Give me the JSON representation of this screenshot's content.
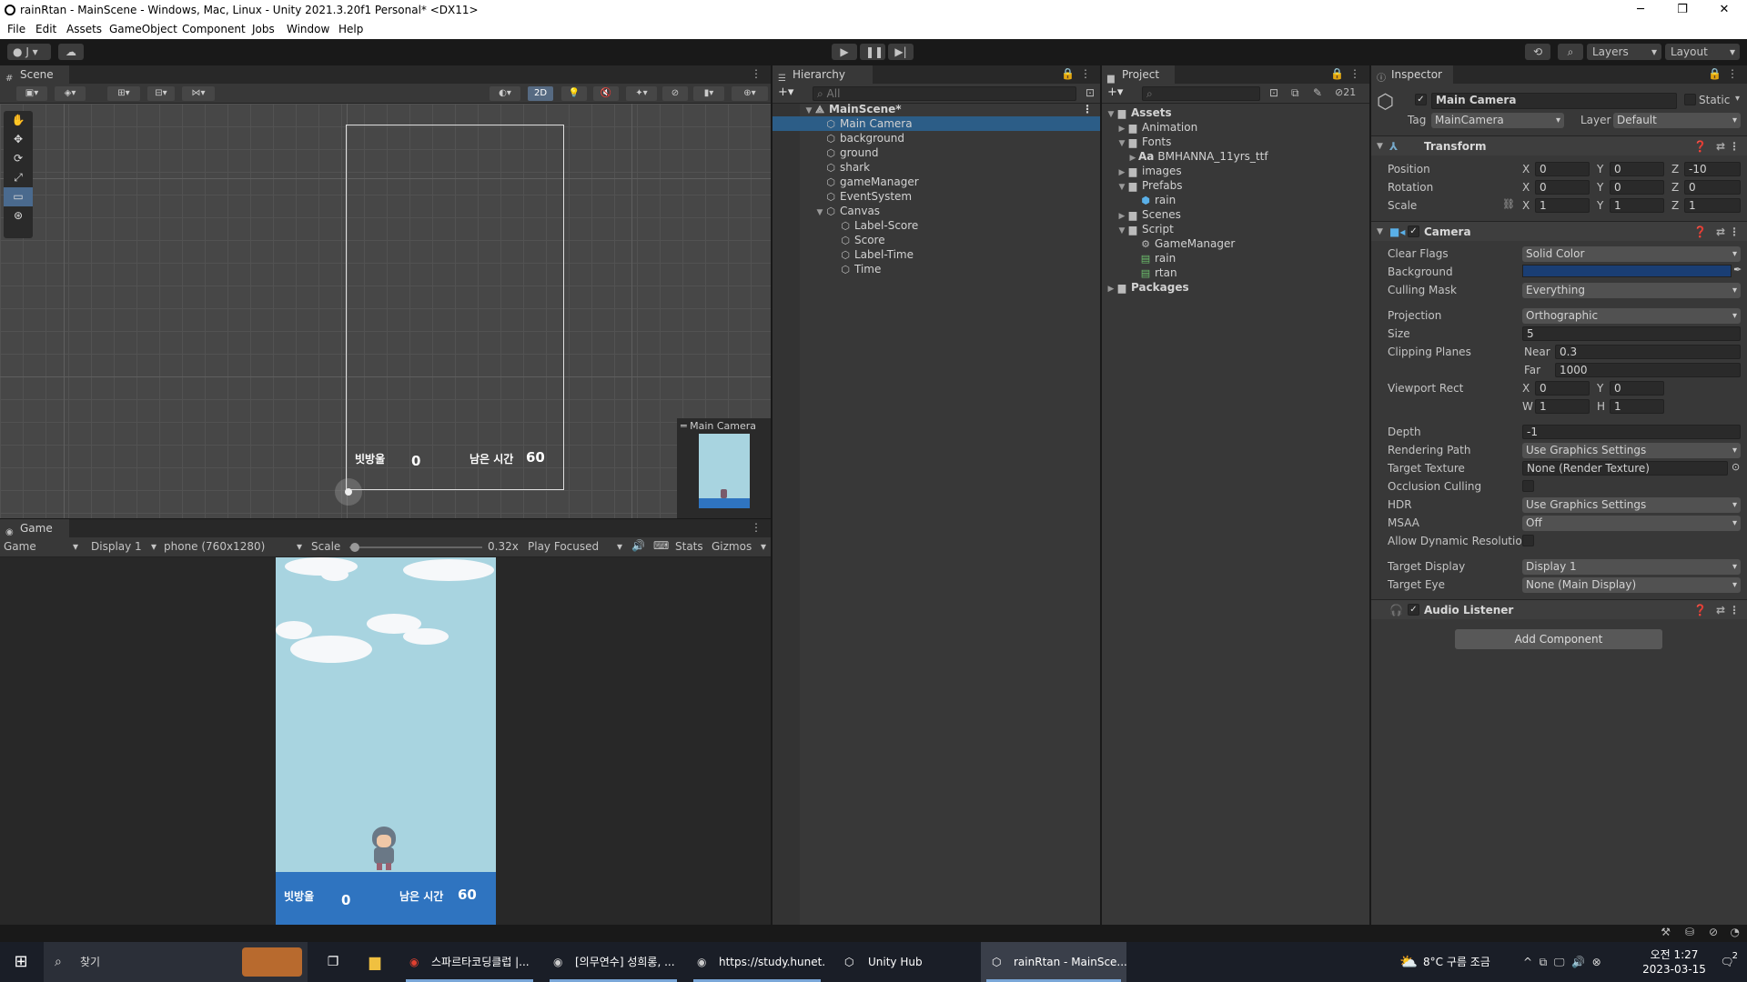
{
  "window": {
    "title": "rainRtan - MainScene - Windows, Mac, Linux - Unity 2021.3.20f1 Personal* <DX11>"
  },
  "menu": [
    "File",
    "Edit",
    "Assets",
    "GameObject",
    "Component",
    "Jobs",
    "Window",
    "Help"
  ],
  "toolbar": {
    "account": "J",
    "layers": "Layers",
    "layout": "Layout"
  },
  "scene": {
    "tab": "Scene",
    "mode_2d": "2D",
    "ui_label_score": "빗방울",
    "ui_score": "0",
    "ui_label_time": "남은 시간",
    "ui_time": "60",
    "camera_preview_title": "Main Camera"
  },
  "game": {
    "tab": "Game",
    "mode": "Game",
    "display": "Display 1",
    "resolution": "phone (760x1280)",
    "scale_label": "Scale",
    "scale_value": "0.32x",
    "focus": "Play Focused",
    "stats": "Stats",
    "gizmos": "Gizmos",
    "label_score": "빗방울",
    "score": "0",
    "label_time": "남은 시간",
    "time": "60",
    "scale_fraction": 0.32
  },
  "hierarchy": {
    "tab": "Hierarchy",
    "search_placeholder": "All",
    "scene_name": "MainScene*",
    "items": [
      {
        "label": "Main Camera",
        "selected": true
      },
      {
        "label": "background"
      },
      {
        "label": "ground"
      },
      {
        "label": "shark"
      },
      {
        "label": "gameManager"
      },
      {
        "label": "EventSystem"
      },
      {
        "label": "Canvas"
      },
      {
        "label": "Label-Score"
      },
      {
        "label": "Score"
      },
      {
        "label": "Label-Time"
      },
      {
        "label": "Time"
      }
    ]
  },
  "project": {
    "tab": "Project",
    "hidden_count": "21",
    "items": [
      "Assets",
      "Animation",
      "Fonts",
      "BMHANNA_11yrs_ttf",
      "images",
      "Prefabs",
      "rain",
      "Scenes",
      "Script",
      "GameManager",
      "rain",
      "rtan",
      "Packages"
    ],
    "font_prefix": "Aa"
  },
  "inspector": {
    "tab": "Inspector",
    "object_name": "Main Camera",
    "static_label": "Static",
    "tag_label": "Tag",
    "tag_value": "MainCamera",
    "layer_label": "Layer",
    "layer_value": "Default",
    "transform": {
      "title": "Transform",
      "position_label": "Position",
      "position": [
        "0",
        "0",
        "-10"
      ],
      "rotation_label": "Rotation",
      "rotation": [
        "0",
        "0",
        "0"
      ],
      "scale_label": "Scale",
      "scale": [
        "1",
        "1",
        "1"
      ]
    },
    "camera": {
      "title": "Camera",
      "clear_flags_label": "Clear Flags",
      "clear_flags": "Solid Color",
      "background_label": "Background",
      "background_color": "#1a3e74",
      "culling_mask_label": "Culling Mask",
      "culling_mask": "Everything",
      "projection_label": "Projection",
      "projection": "Orthographic",
      "size_label": "Size",
      "size": "5",
      "clipping_label": "Clipping Planes",
      "near_label": "Near",
      "near": "0.3",
      "far_label": "Far",
      "far": "1000",
      "viewport_label": "Viewport Rect",
      "vx": "0",
      "vy": "0",
      "vw": "1",
      "vh": "1",
      "depth_label": "Depth",
      "depth": "-1",
      "rendering_path_label": "Rendering Path",
      "rendering_path": "Use Graphics Settings",
      "target_texture_label": "Target Texture",
      "target_texture": "None (Render Texture)",
      "occlusion_label": "Occlusion Culling",
      "hdr_label": "HDR",
      "hdr": "Use Graphics Settings",
      "msaa_label": "MSAA",
      "msaa": "Off",
      "dynres_label": "Allow Dynamic Resolution",
      "target_display_label": "Target Display",
      "target_display": "Display 1",
      "target_eye_label": "Target Eye",
      "target_eye": "None (Main Display)"
    },
    "audio_listener": "Audio Listener",
    "add_component": "Add Component"
  },
  "taskbar": {
    "search": "찾기",
    "tasks": [
      "스파르타코딩클럽 |...",
      "[의무연수] 성희롱, ...",
      "https://study.hunet...",
      "Unity Hub",
      "rainRtan - MainSce..."
    ],
    "weather": "8°C  구름 조금",
    "time": "오전 1:27",
    "date": "2023-03-15",
    "notif_count": "2"
  },
  "colors": {
    "accent": "#2c5d87",
    "sky": "#a8d4e0",
    "ground": "#2f74c0"
  }
}
